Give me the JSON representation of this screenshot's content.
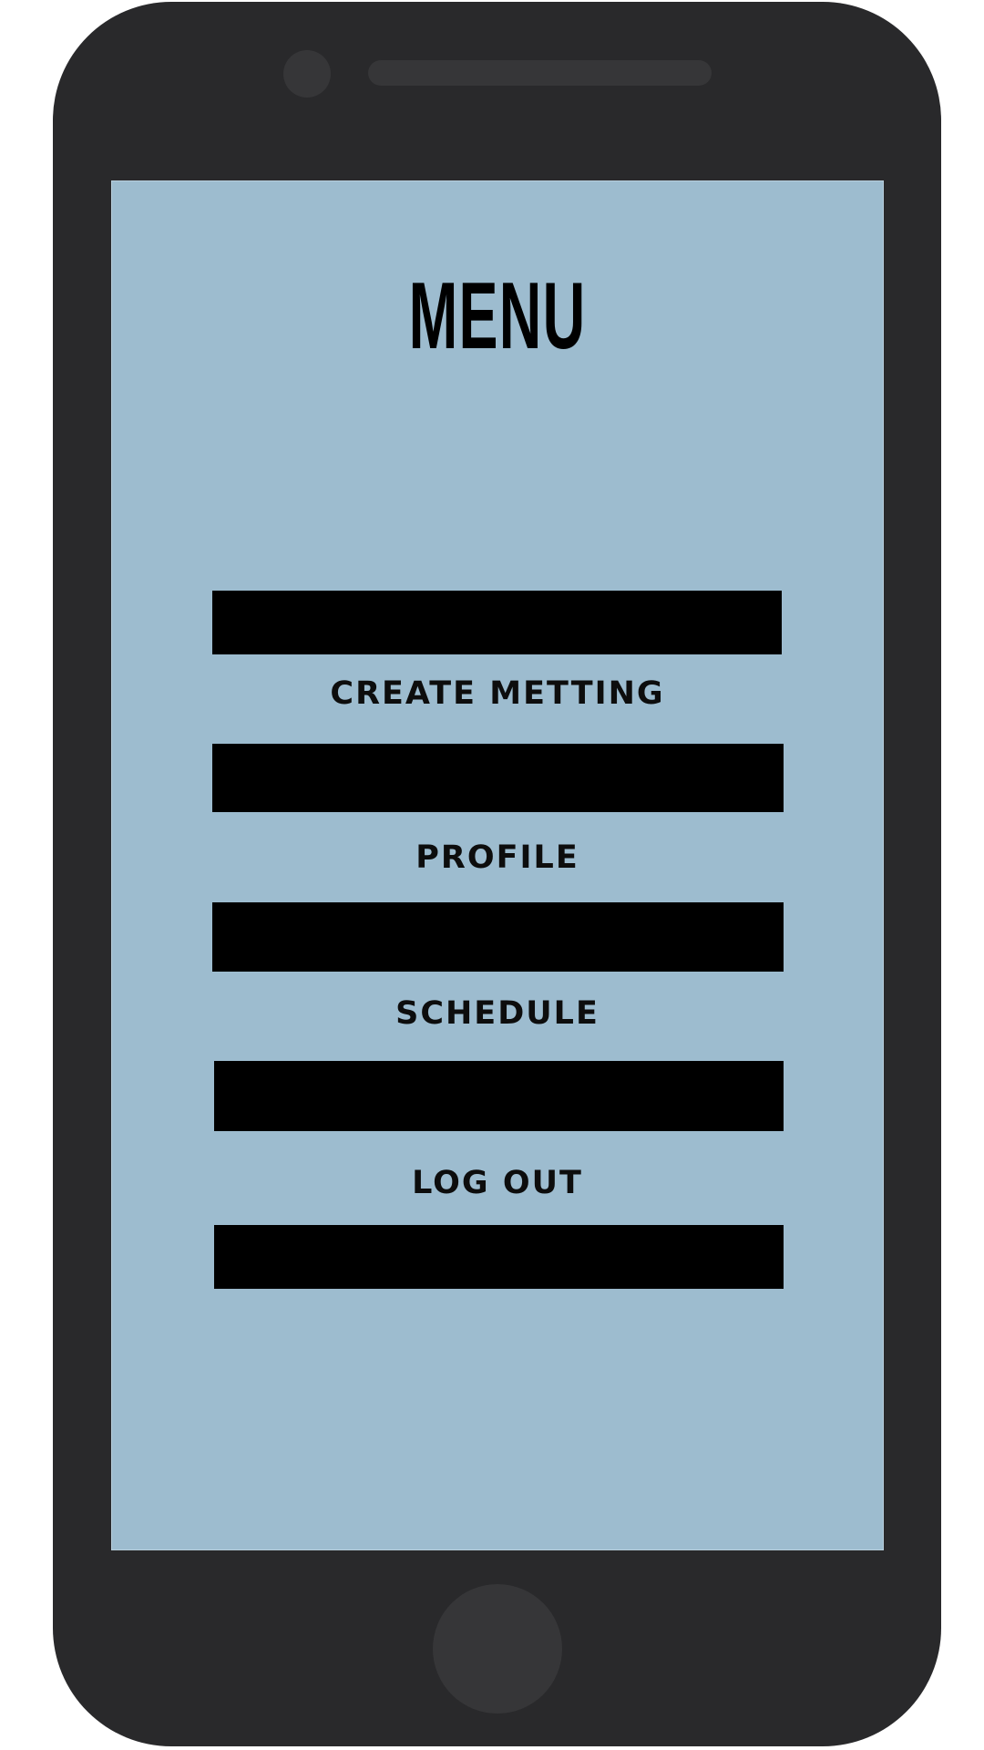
{
  "menu": {
    "title": "MENU",
    "items": [
      {
        "label": "CREATE METTING"
      },
      {
        "label": "PROFILE"
      },
      {
        "label": "SCHEDULE"
      },
      {
        "label": "LOG OUT"
      }
    ]
  },
  "colors": {
    "device_body": "#29292b",
    "device_details": "#363638",
    "screen_background": "#9dbccf",
    "bar_fill": "#000000",
    "text": "#000000"
  }
}
